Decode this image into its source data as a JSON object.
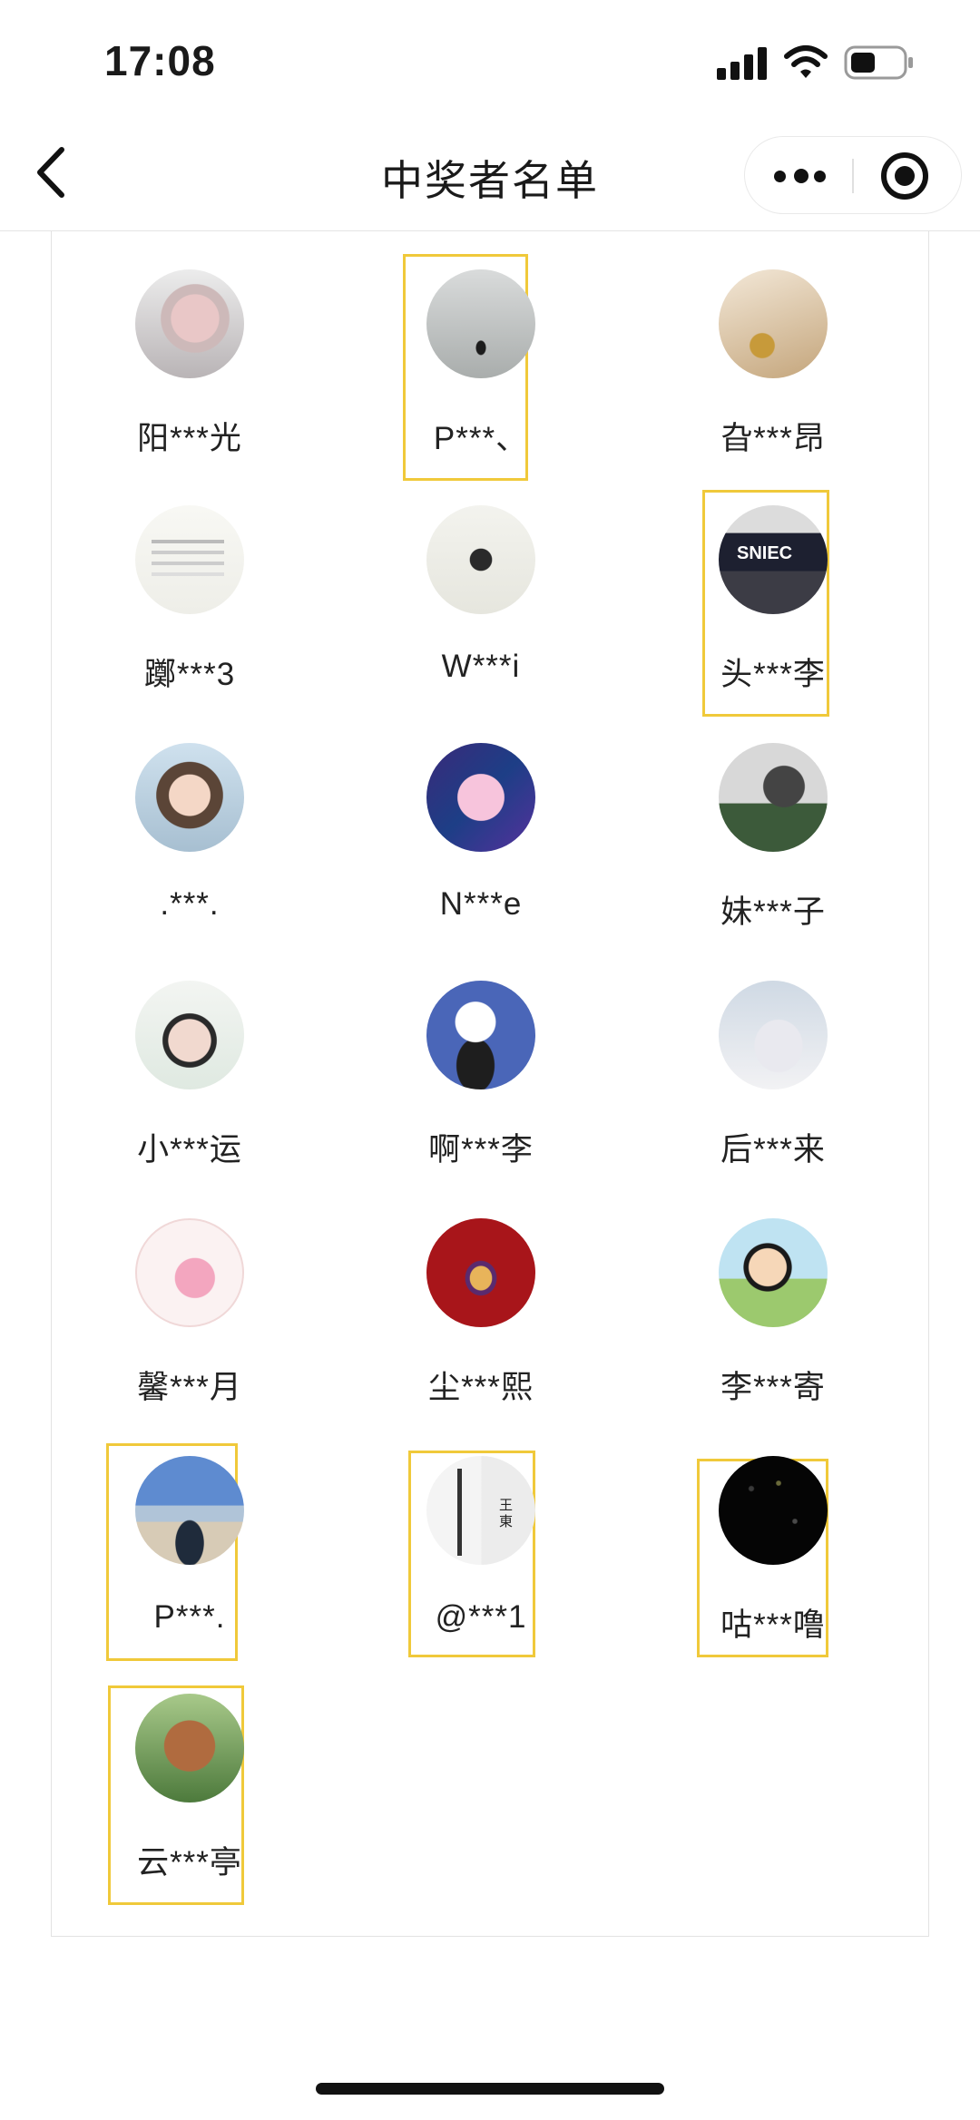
{
  "status_bar": {
    "time": "17:08"
  },
  "nav": {
    "title": "中奖者名单"
  },
  "winners": [
    {
      "name": "阳***光",
      "avatar": "dragon-avatar"
    },
    {
      "name": "P***、",
      "avatar": "person-silhouette-avatar"
    },
    {
      "name": "旮***昂",
      "avatar": "gold-jewelry-avatar"
    },
    {
      "name": "躑***3",
      "avatar": "text-card-avatar"
    },
    {
      "name": "W***i",
      "avatar": "child-walking-avatar"
    },
    {
      "name": "头***李",
      "avatar": "sniec-building-avatar"
    },
    {
      "name": ".***.",
      "avatar": "girl-portrait-avatar"
    },
    {
      "name": "N***e",
      "avatar": "pink-puppy-avatar"
    },
    {
      "name": "妹***子",
      "avatar": "rock-landscape-avatar"
    },
    {
      "name": "小***运",
      "avatar": "glasses-girl-avatar"
    },
    {
      "name": "啊***李",
      "avatar": "cartoon-girl-hat-avatar"
    },
    {
      "name": "后***来",
      "avatar": "woman-white-dress-avatar"
    },
    {
      "name": "馨***月",
      "avatar": "pink-rabbit-avatar"
    },
    {
      "name": "尘***熙",
      "avatar": "cartoon-red-avatar"
    },
    {
      "name": "李***寄",
      "avatar": "crayon-shin-chan-avatar"
    },
    {
      "name": "P***.",
      "avatar": "beach-man-avatar"
    },
    {
      "name": "@***1",
      "avatar": "tower-calligraphy-avatar"
    },
    {
      "name": "咕***噜",
      "avatar": "starry-night-avatar"
    },
    {
      "name": "云***亭",
      "avatar": "poodle-avatar"
    }
  ]
}
